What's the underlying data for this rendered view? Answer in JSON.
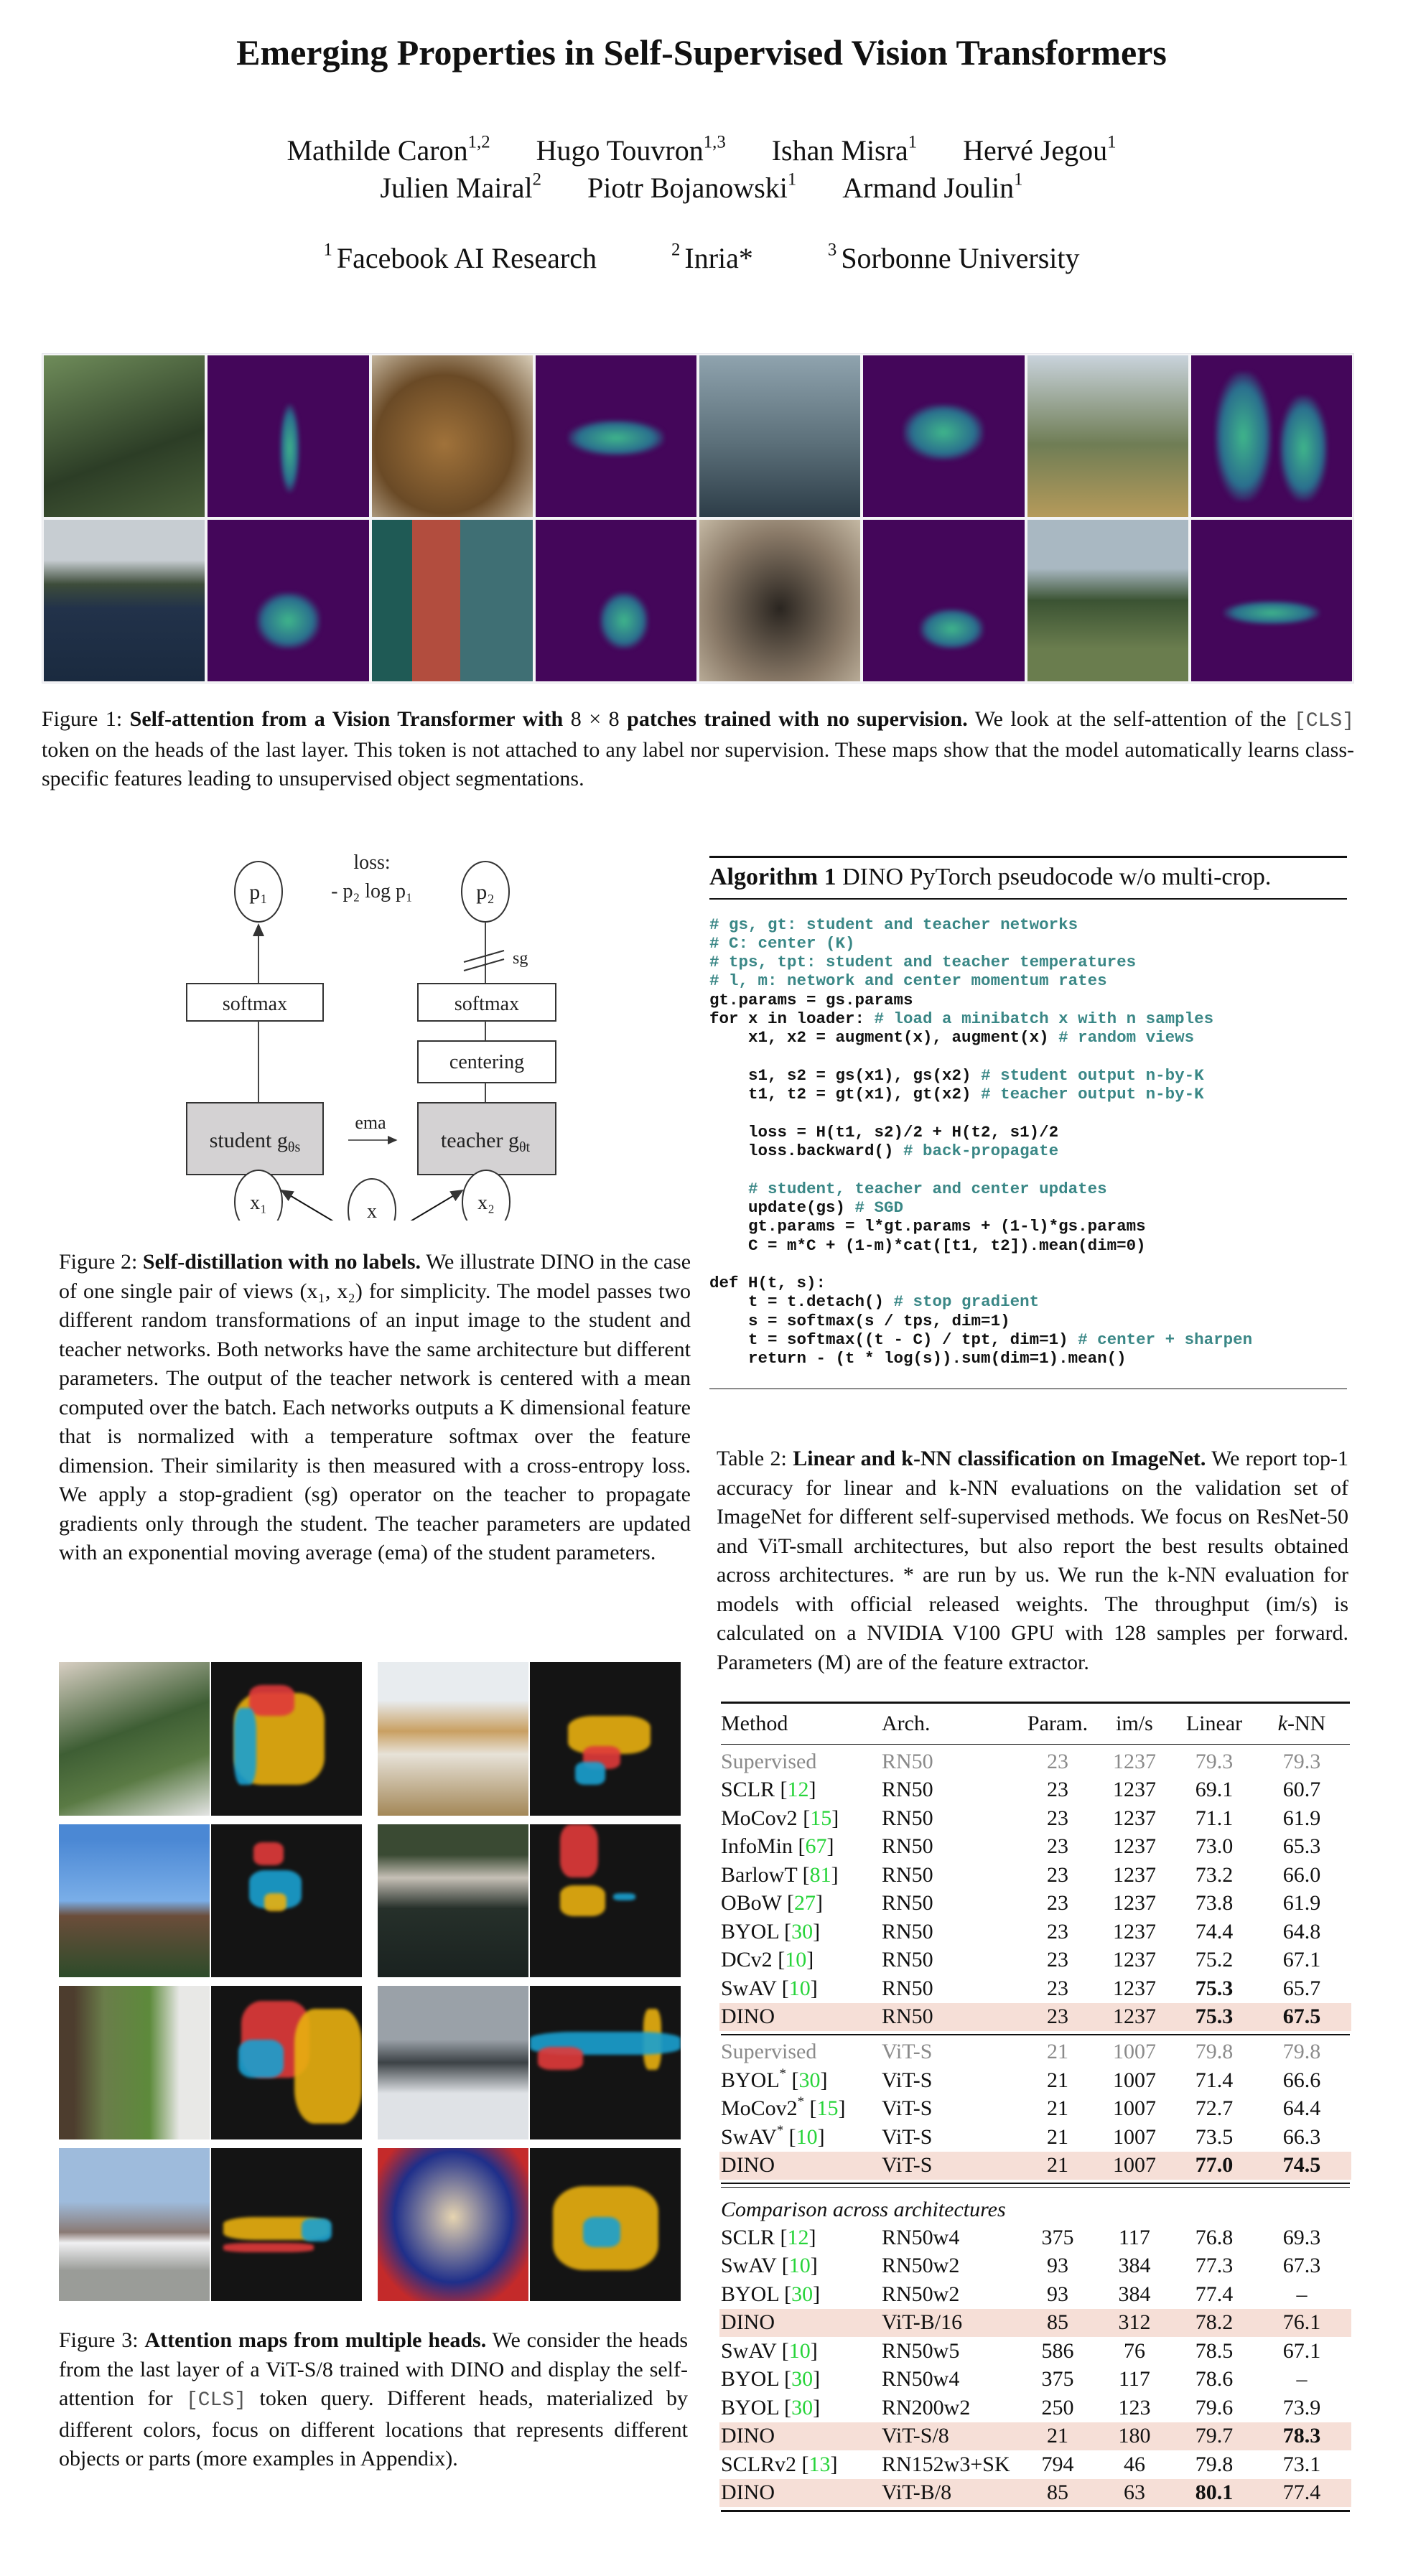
{
  "paper": {
    "title": "Emerging Properties in Self-Supervised Vision Transformers",
    "authors_row1": [
      {
        "name": "Mathilde Caron",
        "aff": "1,2"
      },
      {
        "name": "Hugo Touvron",
        "aff": "1,3"
      },
      {
        "name": "Ishan Misra",
        "aff": "1"
      },
      {
        "name": "Hervé Jegou",
        "aff": "1"
      }
    ],
    "authors_row2": [
      {
        "name": "Julien Mairal",
        "aff": "2"
      },
      {
        "name": "Piotr Bojanowski",
        "aff": "1"
      },
      {
        "name": "Armand Joulin",
        "aff": "1"
      }
    ],
    "affiliations": [
      {
        "num": "1",
        "name": "Facebook AI Research"
      },
      {
        "num": "2",
        "name": "Inria*"
      },
      {
        "num": "3",
        "name": "Sorbonne University"
      }
    ]
  },
  "figure1": {
    "rows": [
      [
        "bird photo",
        "bird attention map",
        "toy elephant with toothbrush photo",
        "toothbrush attention map",
        "parliament building photo",
        "building attention map",
        "giraffes photo",
        "giraffes attention map"
      ],
      [
        "sailboat photo",
        "sailboat attention map",
        "bicycle by door photo",
        "bicycle attention map",
        "dog on armchair photo",
        "dog attention map",
        "airplane landing photo",
        "airplane attention map"
      ]
    ],
    "caption_label": "Figure 1:",
    "caption_bold_a": "Self-attention from a Vision Transformer with",
    "caption_math": "8 × 8",
    "caption_bold_b": "patches trained with no supervision.",
    "caption_text_a": "We look at the self-attention of the",
    "caption_token": "[CLS]",
    "caption_text_b": "token on the heads of the last layer. This token is not attached to any label nor supervision. These maps show that the model automatically learns class-specific features leading to unsupervised object segmentations."
  },
  "figure2": {
    "loss_label": "loss:",
    "loss_formula": "- p₂ log p₁",
    "p1": "p₁",
    "p2": "p₂",
    "sg": "sg",
    "softmax": "softmax",
    "centering": "centering",
    "student": "student g",
    "student_sub": "θs",
    "teacher": "teacher g",
    "teacher_sub": "θt",
    "ema": "ema",
    "x1": "x₁",
    "x2": "x₂",
    "x": "x",
    "caption_label": "Figure 2:",
    "caption_bold": "Self-distillation with no labels.",
    "caption_text": "We illustrate DINO in the case of one single pair of views (x₁, x₂) for simplicity. The model passes two different random transformations of an input image to the student and teacher networks. Both networks have the same architecture but different parameters. The output of the teacher network is centered with a mean computed over the batch. Each networks outputs a K dimensional feature that is normalized with a temperature softmax over the feature dimension. Their similarity is then measured with a cross-entropy loss. We apply a stop-gradient (sg) operator on the teacher to propagate gradients only through the student. The teacher parameters are updated with an exponential moving average (ema) of the student parameters."
  },
  "algorithm": {
    "label": "Algorithm 1",
    "title": "DINO PyTorch pseudocode w/o multi-crop.",
    "lines": [
      [
        {
          "t": "# gs, gt: student and teacher networks",
          "c": true
        }
      ],
      [
        {
          "t": "# C: center (K)",
          "c": true
        }
      ],
      [
        {
          "t": "# tps, tpt: student and teacher temperatures",
          "c": true
        }
      ],
      [
        {
          "t": "# l, m: network and center momentum rates",
          "c": true
        }
      ],
      [
        {
          "t": "gt.params = gs.params",
          "c": false
        }
      ],
      [
        {
          "t": "for x in loader: ",
          "c": false
        },
        {
          "t": "# load a minibatch x with n samples",
          "c": true
        }
      ],
      [
        {
          "t": "    x1, x2 = augment(x), augment(x) ",
          "c": false
        },
        {
          "t": "# random views",
          "c": true
        }
      ],
      [
        {
          "t": "",
          "c": false
        }
      ],
      [
        {
          "t": "    s1, s2 = gs(x1), gs(x2) ",
          "c": false
        },
        {
          "t": "# student output n-by-K",
          "c": true
        }
      ],
      [
        {
          "t": "    t1, t2 = gt(x1), gt(x2) ",
          "c": false
        },
        {
          "t": "# teacher output n-by-K",
          "c": true
        }
      ],
      [
        {
          "t": "",
          "c": false
        }
      ],
      [
        {
          "t": "    loss = H(t1, s2)/2 + H(t2, s1)/2",
          "c": false
        }
      ],
      [
        {
          "t": "    loss.backward() ",
          "c": false
        },
        {
          "t": "# back-propagate",
          "c": true
        }
      ],
      [
        {
          "t": "",
          "c": false
        }
      ],
      [
        {
          "t": "    # student, teacher and center updates",
          "c": true
        }
      ],
      [
        {
          "t": "    update(gs) ",
          "c": false
        },
        {
          "t": "# SGD",
          "c": true
        }
      ],
      [
        {
          "t": "    gt.params = l*gt.params + (1-l)*gs.params",
          "c": false
        }
      ],
      [
        {
          "t": "    C = m*C + (1-m)*cat([t1, t2]).mean(dim=0)",
          "c": false
        }
      ],
      [
        {
          "t": "",
          "c": false
        }
      ],
      [
        {
          "t": "def H(t, s):",
          "c": false
        }
      ],
      [
        {
          "t": "    t = t.detach() ",
          "c": false
        },
        {
          "t": "# stop gradient",
          "c": true
        }
      ],
      [
        {
          "t": "    s = softmax(s / tps, dim=1)",
          "c": false
        }
      ],
      [
        {
          "t": "    t = softmax((t - C) / tpt, dim=1) ",
          "c": false
        },
        {
          "t": "# center + sharpen",
          "c": true
        }
      ],
      [
        {
          "t": "    return - (t * log(s)).sum(dim=1).mean()",
          "c": false
        }
      ]
    ]
  },
  "table2": {
    "caption_label": "Table 2:",
    "caption_bold": "Linear and k-NN classification on ImageNet.",
    "caption_text": "We report top-1 accuracy for linear and k-NN evaluations on the validation set of ImageNet for different self-supervised methods. We focus on ResNet-50 and ViT-small architectures, but also report the best results obtained across architectures. * are run by us. We run the k-NN evaluation for models with official released weights. The throughput (im/s) is calculated on a NVIDIA V100 GPU with 128 samples per forward. Parameters (M) are of the feature extractor.",
    "headers": [
      "Method",
      "Arch.",
      "Param.",
      "im/s",
      "Linear",
      "k-NN"
    ],
    "sections": [
      {
        "title": "",
        "rows": [
          {
            "method": "Supervised",
            "ref": "",
            "star": false,
            "arch": "RN50",
            "param": "23",
            "ims": "1237",
            "linear": "79.3",
            "knn": "79.3",
            "style": "supervised"
          },
          {
            "method": "SCLR",
            "ref": "12",
            "star": false,
            "arch": "RN50",
            "param": "23",
            "ims": "1237",
            "linear": "69.1",
            "knn": "60.7"
          },
          {
            "method": "MoCov2",
            "ref": "15",
            "star": false,
            "arch": "RN50",
            "param": "23",
            "ims": "1237",
            "linear": "71.1",
            "knn": "61.9"
          },
          {
            "method": "InfoMin",
            "ref": "67",
            "star": false,
            "arch": "RN50",
            "param": "23",
            "ims": "1237",
            "linear": "73.0",
            "knn": "65.3"
          },
          {
            "method": "BarlowT",
            "ref": "81",
            "star": false,
            "arch": "RN50",
            "param": "23",
            "ims": "1237",
            "linear": "73.2",
            "knn": "66.0"
          },
          {
            "method": "OBoW",
            "ref": "27",
            "star": false,
            "arch": "RN50",
            "param": "23",
            "ims": "1237",
            "linear": "73.8",
            "knn": "61.9"
          },
          {
            "method": "BYOL",
            "ref": "30",
            "star": false,
            "arch": "RN50",
            "param": "23",
            "ims": "1237",
            "linear": "74.4",
            "knn": "64.8"
          },
          {
            "method": "DCv2",
            "ref": "10",
            "star": false,
            "arch": "RN50",
            "param": "23",
            "ims": "1237",
            "linear": "75.2",
            "knn": "67.1"
          },
          {
            "method": "SwAV",
            "ref": "10",
            "star": false,
            "arch": "RN50",
            "param": "23",
            "ims": "1237",
            "linear": "75.3",
            "knn": "65.7",
            "bold_linear": true
          },
          {
            "method": "DINO",
            "ref": "",
            "star": false,
            "arch": "RN50",
            "param": "23",
            "ims": "1237",
            "linear": "75.3",
            "knn": "67.5",
            "style": "highlight",
            "bold_linear": true,
            "bold_knn": true
          }
        ]
      },
      {
        "title": "",
        "rows": [
          {
            "method": "Supervised",
            "ref": "",
            "star": false,
            "arch": "ViT-S",
            "param": "21",
            "ims": "1007",
            "linear": "79.8",
            "knn": "79.8",
            "style": "supervised"
          },
          {
            "method": "BYOL",
            "ref": "30",
            "star": true,
            "arch": "ViT-S",
            "param": "21",
            "ims": "1007",
            "linear": "71.4",
            "knn": "66.6"
          },
          {
            "method": "MoCov2",
            "ref": "15",
            "star": true,
            "arch": "ViT-S",
            "param": "21",
            "ims": "1007",
            "linear": "72.7",
            "knn": "64.4"
          },
          {
            "method": "SwAV",
            "ref": "10",
            "star": true,
            "arch": "ViT-S",
            "param": "21",
            "ims": "1007",
            "linear": "73.5",
            "knn": "66.3"
          },
          {
            "method": "DINO",
            "ref": "",
            "star": false,
            "arch": "ViT-S",
            "param": "21",
            "ims": "1007",
            "linear": "77.0",
            "knn": "74.5",
            "style": "highlight",
            "bold_linear": true,
            "bold_knn": true
          }
        ]
      },
      {
        "title": "Comparison across architectures",
        "rows": [
          {
            "method": "SCLR",
            "ref": "12",
            "star": false,
            "arch": "RN50w4",
            "param": "375",
            "ims": "117",
            "linear": "76.8",
            "knn": "69.3"
          },
          {
            "method": "SwAV",
            "ref": "10",
            "star": false,
            "arch": "RN50w2",
            "param": "93",
            "ims": "384",
            "linear": "77.3",
            "knn": "67.3"
          },
          {
            "method": "BYOL",
            "ref": "30",
            "star": false,
            "arch": "RN50w2",
            "param": "93",
            "ims": "384",
            "linear": "77.4",
            "knn": "–"
          },
          {
            "method": "DINO",
            "ref": "",
            "star": false,
            "arch": "ViT-B/16",
            "param": "85",
            "ims": "312",
            "linear": "78.2",
            "knn": "76.1",
            "style": "highlight"
          },
          {
            "method": "SwAV",
            "ref": "10",
            "star": false,
            "arch": "RN50w5",
            "param": "586",
            "ims": "76",
            "linear": "78.5",
            "knn": "67.1"
          },
          {
            "method": "BYOL",
            "ref": "30",
            "star": false,
            "arch": "RN50w4",
            "param": "375",
            "ims": "117",
            "linear": "78.6",
            "knn": "–"
          },
          {
            "method": "BYOL",
            "ref": "30",
            "star": false,
            "arch": "RN200w2",
            "param": "250",
            "ims": "123",
            "linear": "79.6",
            "knn": "73.9"
          },
          {
            "method": "DINO",
            "ref": "",
            "star": false,
            "arch": "ViT-S/8",
            "param": "21",
            "ims": "180",
            "linear": "79.7",
            "knn": "78.3",
            "style": "highlight",
            "bold_knn": true
          },
          {
            "method": "SCLRv2",
            "ref": "13",
            "star": false,
            "arch": "RN152w3+SK",
            "param": "794",
            "ims": "46",
            "linear": "79.8",
            "knn": "73.1"
          },
          {
            "method": "DINO",
            "ref": "",
            "star": false,
            "arch": "ViT-B/8",
            "param": "85",
            "ims": "63",
            "linear": "80.1",
            "knn": "77.4",
            "style": "highlight",
            "bold_linear": true
          }
        ]
      }
    ]
  },
  "figure3": {
    "rows": [
      [
        "vegetables photo",
        "vegetables multi-head attention",
        "french toast plate photo",
        "french toast multi-head attention"
      ],
      [
        "clock tower photo",
        "clock tower multi-head attention",
        "river houses photo",
        "river houses multi-head attention"
      ],
      [
        "zebra-horse photo",
        "zebra-horse multi-head attention",
        "stop sign snowy road photo",
        "stop sign multi-head attention"
      ],
      [
        "fedex truck photo",
        "fedex truck multi-head attention",
        "teddy bear photo",
        "teddy bear multi-head attention"
      ]
    ],
    "caption_label": "Figure 3:",
    "caption_bold": "Attention maps from multiple heads.",
    "caption_text_a": "We consider the heads from the last layer of a ViT-S/8 trained with DINO and display the self-attention for",
    "caption_token": "[CLS]",
    "caption_text_b": "token query. Different heads, materialized by different colors, focus on different locations that represents different objects or parts (more examples in Appendix).",
    "head_colors": [
      "#e8b010",
      "#e03a3a",
      "#1aa0d0"
    ]
  },
  "colors": {
    "code_comment": "#3a8786",
    "citation": "#27d43a",
    "highlight_row": "#f6dfd7",
    "supervised_gray": "#8a8a8a",
    "viridis_bg": "#44065a"
  }
}
